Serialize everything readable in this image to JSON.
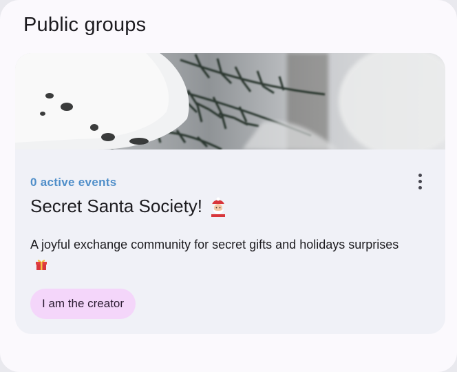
{
  "section": {
    "title": "Public groups"
  },
  "group_card": {
    "image_icon": "snowy-pine-branch-image",
    "active_events": "0 active events",
    "title": "Secret Santa Society!",
    "title_icon": "santa-icon",
    "description": "A joyful exchange community for secret gifts and holidays surprises",
    "description_icon": "gift-icon",
    "menu_icon": "more-vert-icon",
    "chip_label": "I am the creator",
    "colors": {
      "events_text": "#4f8ec9",
      "chip_background": "#f4d6fa",
      "card_background": "#f0f1f7"
    }
  }
}
